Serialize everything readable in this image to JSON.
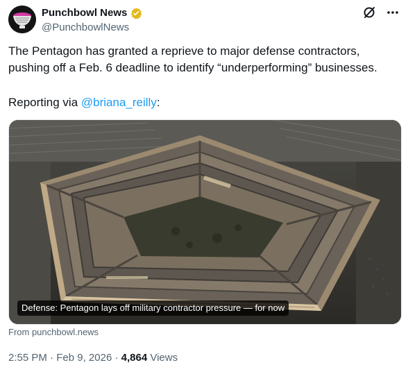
{
  "author": {
    "display_name": "Punchbowl News",
    "handle": "@PunchbowlNews",
    "avatar_icon": "punchbowl-logo-icon",
    "verified_color": "#e2b719"
  },
  "actions": {
    "grok_icon": "grok-icon",
    "more_icon": "more-horizontal-icon"
  },
  "tweet": {
    "text": "The Pentagon has granted a reprieve to major defense contractors, pushing off a Feb. 6 deadline to identify “underperforming” businesses.",
    "reporting_prefix": "Reporting via ",
    "mention": "@briana_reilly",
    "reporting_suffix": ":"
  },
  "card": {
    "image_subject": "aerial view of the Pentagon",
    "caption": "Defense: Pentagon lays off military contractor pressure — for now",
    "source": "From punchbowl.news"
  },
  "meta": {
    "time": "2:55 PM",
    "sep1": " · ",
    "date": "Feb 9, 2026",
    "sep2": " · ",
    "views_count": "4,864",
    "views_label": " Views"
  },
  "colors": {
    "accent": "#1d9bf0",
    "muted": "#536471",
    "text": "#0f1419"
  }
}
